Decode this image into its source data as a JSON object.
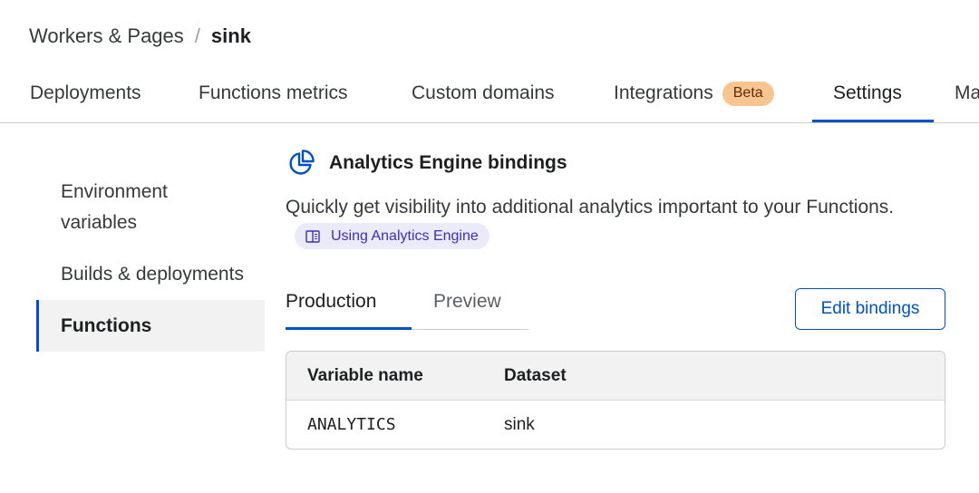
{
  "breadcrumb": {
    "parent": "Workers & Pages",
    "separator": "/",
    "current": "sink"
  },
  "tabs": [
    {
      "label": "Deployments"
    },
    {
      "label": "Functions metrics"
    },
    {
      "label": "Custom domains"
    },
    {
      "label": "Integrations",
      "badge": "Beta"
    },
    {
      "label": "Settings",
      "active": true
    },
    {
      "label": "Ma"
    }
  ],
  "subnav": {
    "items": [
      {
        "label": "Environment variables"
      },
      {
        "label": "Builds & deployments"
      },
      {
        "label": "Functions",
        "active": true
      }
    ]
  },
  "section": {
    "icon": "pie-chart-icon",
    "title": "Analytics Engine bindings",
    "description": "Quickly get visibility into additional analytics important to your Functions.",
    "doc_link_icon": "book-icon",
    "doc_link": "Using Analytics Engine"
  },
  "env_tabs": [
    {
      "label": "Production",
      "active": true
    },
    {
      "label": "Preview"
    }
  ],
  "edit_button": "Edit bindings",
  "table": {
    "headers": [
      "Variable name",
      "Dataset"
    ],
    "rows": [
      [
        "ANALYTICS",
        "sink"
      ]
    ]
  },
  "colors": {
    "accent": "#0051c3",
    "badge_bg": "#f8c591",
    "doc_pill_bg": "#ebeaf9",
    "doc_pill_text": "#3b2fb6"
  }
}
